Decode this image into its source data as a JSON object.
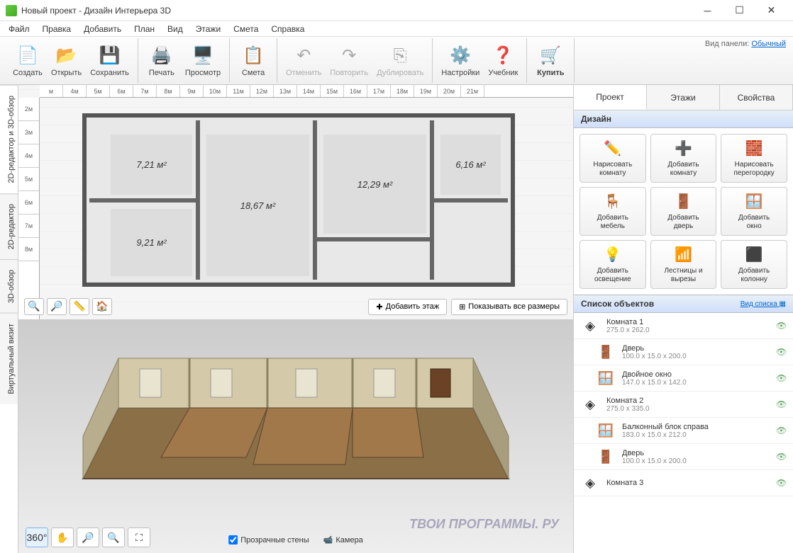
{
  "window": {
    "title": "Новый проект - Дизайн Интерьера 3D"
  },
  "menu": [
    "Файл",
    "Правка",
    "Добавить",
    "План",
    "Вид",
    "Этажи",
    "Смета",
    "Справка"
  ],
  "toolbar": {
    "groups": [
      {
        "items": [
          {
            "id": "create",
            "label": "Создать",
            "icon": "📄"
          },
          {
            "id": "open",
            "label": "Открыть",
            "icon": "📂"
          },
          {
            "id": "save",
            "label": "Сохранить",
            "icon": "💾"
          }
        ]
      },
      {
        "items": [
          {
            "id": "print",
            "label": "Печать",
            "icon": "🖨️"
          },
          {
            "id": "preview",
            "label": "Просмотр",
            "icon": "🖥️"
          }
        ]
      },
      {
        "items": [
          {
            "id": "estimate",
            "label": "Смета",
            "icon": "📋"
          }
        ]
      },
      {
        "items": [
          {
            "id": "undo",
            "label": "Отменить",
            "icon": "↶",
            "disabled": true
          },
          {
            "id": "redo",
            "label": "Повторить",
            "icon": "↷",
            "disabled": true
          },
          {
            "id": "duplicate",
            "label": "Дублировать",
            "icon": "⎘",
            "disabled": true
          }
        ]
      },
      {
        "items": [
          {
            "id": "settings",
            "label": "Настройки",
            "icon": "⚙️"
          },
          {
            "id": "help",
            "label": "Учебник",
            "icon": "❓"
          }
        ]
      },
      {
        "items": [
          {
            "id": "buy",
            "label": "Купить",
            "icon": "🛒",
            "highlight": true
          }
        ]
      }
    ],
    "panel_label": "Вид панели:",
    "panel_mode": "Обычный"
  },
  "sidetabs": [
    "2D-редактор и 3D-обзор",
    "2D-редактор",
    "3D-обзор",
    "Виртуальный визит"
  ],
  "ruler_h": [
    "м",
    "4м",
    "5м",
    "6м",
    "7м",
    "8м",
    "9м",
    "10м",
    "11м",
    "12м",
    "13м",
    "14м",
    "15м",
    "16м",
    "17м",
    "18м",
    "19м",
    "20м",
    "21м"
  ],
  "ruler_v": [
    "2м",
    "3м",
    "4м",
    "5м",
    "6м",
    "7м",
    "8м"
  ],
  "rooms": [
    {
      "area": "7,21 м²"
    },
    {
      "area": "18,67 м²"
    },
    {
      "area": "12,29 м²"
    },
    {
      "area": "6,16 м²"
    },
    {
      "area": "9,21 м²"
    }
  ],
  "plan_actions": {
    "add_floor": "Добавить этаж",
    "show_dims": "Показывать все размеры"
  },
  "view3d_controls": {
    "transparent_walls": "Прозрачные стены",
    "camera": "Камера"
  },
  "rp_tabs": [
    "Проект",
    "Этажи",
    "Свойства"
  ],
  "design_section": "Дизайн",
  "design_buttons": [
    {
      "id": "draw-room",
      "label": "Нарисовать\nкомнату",
      "icon": "✏️"
    },
    {
      "id": "add-room",
      "label": "Добавить\nкомнату",
      "icon": "➕"
    },
    {
      "id": "draw-partition",
      "label": "Нарисовать\nперегородку",
      "icon": "🧱"
    },
    {
      "id": "add-furniture",
      "label": "Добавить\nмебель",
      "icon": "🪑"
    },
    {
      "id": "add-door",
      "label": "Добавить\nдверь",
      "icon": "🚪"
    },
    {
      "id": "add-window",
      "label": "Добавить\nокно",
      "icon": "🪟"
    },
    {
      "id": "add-lighting",
      "label": "Добавить\nосвещение",
      "icon": "💡"
    },
    {
      "id": "stairs",
      "label": "Лестницы и\nвырезы",
      "icon": "📶"
    },
    {
      "id": "add-column",
      "label": "Добавить\nколонну",
      "icon": "⬛"
    }
  ],
  "objects_section": "Список объектов",
  "objects_view": "Вид списка",
  "objects": [
    {
      "name": "Комната 1",
      "dims": "275.0 x 262.0",
      "icon": "◈",
      "indent": 0
    },
    {
      "name": "Дверь",
      "dims": "100.0 x 15.0 x 200.0",
      "icon": "🚪",
      "indent": 1
    },
    {
      "name": "Двойное окно",
      "dims": "147.0 x 15.0 x 142.0",
      "icon": "🪟",
      "indent": 1
    },
    {
      "name": "Комната 2",
      "dims": "275.0 x 335.0",
      "icon": "◈",
      "indent": 0
    },
    {
      "name": "Балконный блок справа",
      "dims": "183.0 x 15.0 x 212.0",
      "icon": "🪟",
      "indent": 1
    },
    {
      "name": "Дверь",
      "dims": "100.0 x 15.0 x 200.0",
      "icon": "🚪",
      "indent": 1
    },
    {
      "name": "Комната 3",
      "dims": "",
      "icon": "◈",
      "indent": 0
    }
  ],
  "watermark": "ТВОИ ПРОГРАММЫ. РУ"
}
